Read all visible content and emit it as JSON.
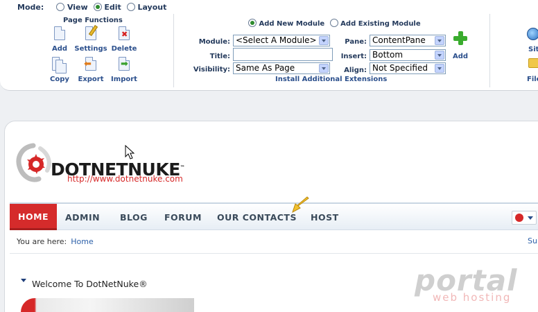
{
  "mode": {
    "label": "Mode:",
    "options": [
      "View",
      "Edit",
      "Layout"
    ],
    "selected": "Edit"
  },
  "page_functions": {
    "title": "Page Functions",
    "buttons": [
      "Add",
      "Settings",
      "Delete",
      "Copy",
      "Export",
      "Import"
    ]
  },
  "module": {
    "add_new_label": "Add New Module",
    "add_existing_label": "Add Existing Module",
    "selected_option": "Add New Module",
    "module_label": "Module:",
    "module_value": "<Select A Module>",
    "title_label": "Title:",
    "title_value": "",
    "visibility_label": "Visibility:",
    "visibility_value": "Same As Page",
    "pane_label": "Pane:",
    "pane_value": "ContentPane",
    "insert_label": "Insert:",
    "insert_value": "Bottom",
    "align_label": "Align:",
    "align_value": "Not Specified",
    "add_button": "Add",
    "install_link": "Install Additional Extensions"
  },
  "right_panel": {
    "items": [
      "Sit",
      "File"
    ]
  },
  "site": {
    "logo_text": "DOTNETNUKE",
    "logo_tm": "™",
    "logo_url": "http://www.dotnetnuke.com",
    "menu": [
      "HOME",
      "ADMIN",
      "BLOG",
      "FORUM",
      "OUR CONTACTS",
      "HOST"
    ],
    "active_menu": "HOME",
    "breadcrumb_label": "You are here:",
    "breadcrumb_link": "Home",
    "right_link": "Su",
    "module_title": "Welcome To DotNetNuke®"
  },
  "watermark": {
    "line1": "portal",
    "line2": "web hosting"
  },
  "colors": {
    "accent_red": "#d52b2b",
    "link_blue": "#2b4f8c",
    "add_green": "#3aac2e"
  }
}
